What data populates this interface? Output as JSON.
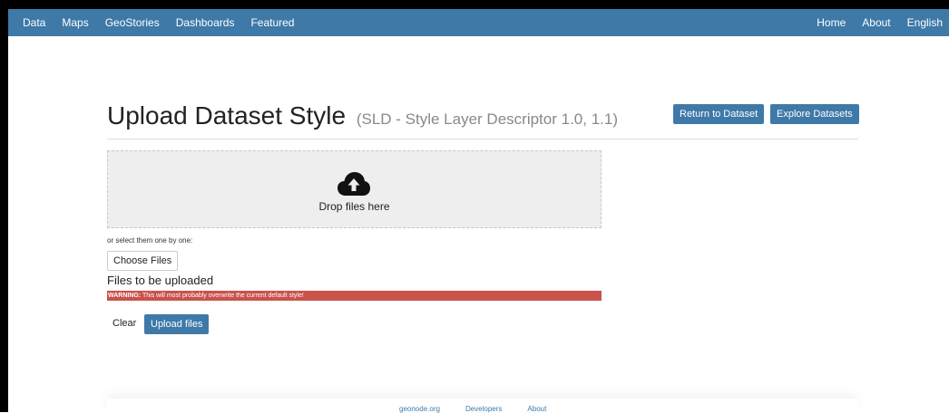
{
  "navbar": {
    "left_items": [
      "Data",
      "Maps",
      "GeoStories",
      "Dashboards",
      "Featured"
    ],
    "right_items": [
      "Home",
      "About",
      "English"
    ],
    "color": "#3e79a8"
  },
  "page": {
    "title": "Upload Dataset Style",
    "subtitle": "(SLD - Style Layer Descriptor 1.0, 1.1)"
  },
  "actions": {
    "return_label": "Return to Dataset",
    "explore_label": "Explore Datasets"
  },
  "dropzone": {
    "icon": "cloud-upload-icon",
    "text": "Drop files here"
  },
  "select": {
    "hint": "or select them one by one:",
    "choose_label": "Choose Files"
  },
  "files": {
    "heading": "Files to be uploaded",
    "warning_prefix": "WARNING:",
    "warning_text": "This will most probably overwrite the current default style!",
    "warning_color": "#c9524c"
  },
  "buttons": {
    "clear_label": "Clear",
    "upload_label": "Upload files"
  },
  "footer": {
    "links": [
      "geonode.org",
      "Developers",
      "About"
    ]
  }
}
